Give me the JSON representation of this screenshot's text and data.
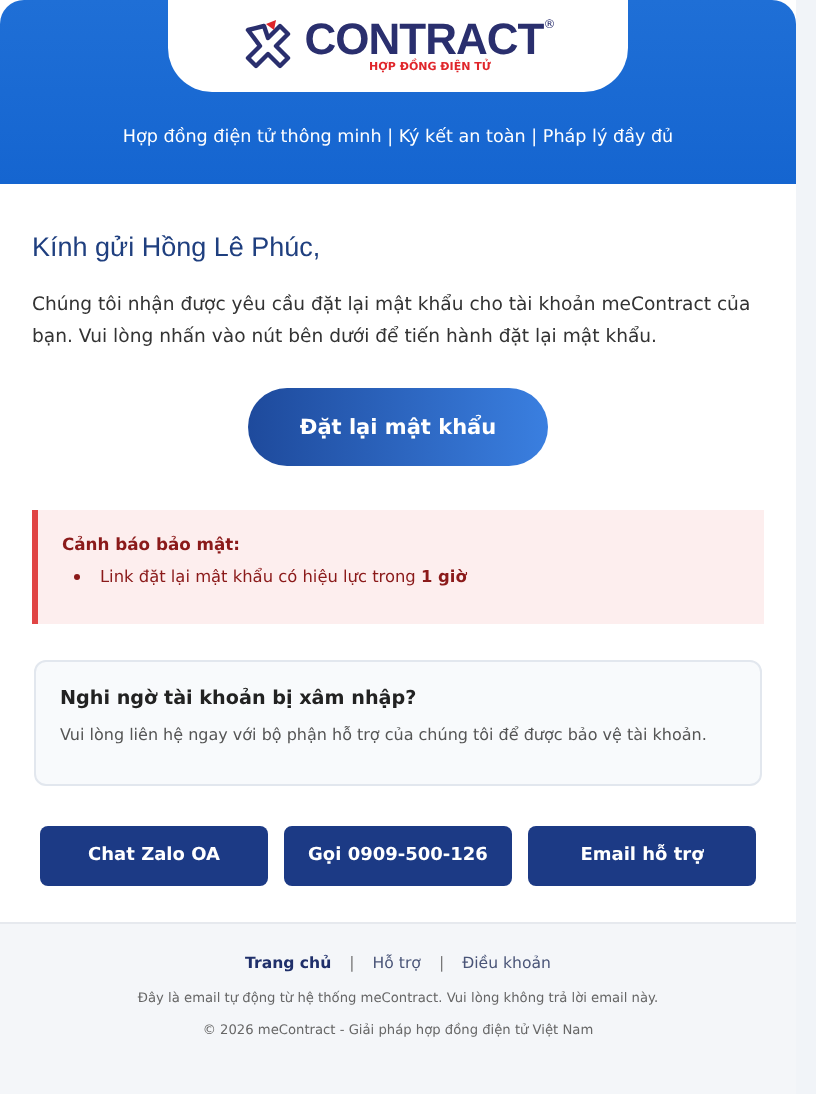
{
  "header": {
    "logo": {
      "wordmark": "CONTRACT",
      "registered": "®",
      "tagline": "HỢP ĐỒNG ĐIỆN TỬ"
    },
    "slogan": "Hợp đồng điện tử thông minh | Ký kết an toàn | Pháp lý đầy đủ"
  },
  "greeting": "Kính gửi Hồng Lê Phúc,",
  "message": "Chúng tôi nhận được yêu cầu đặt lại mật khẩu cho tài khoản meContract của bạn. Vui lòng nhấn vào nút bên dưới để tiến hành đặt lại mật khẩu.",
  "reset_button": "Đặt lại mật khẩu",
  "security_alert": {
    "title": "Cảnh báo bảo mật:",
    "items": [
      "Link đặt lại mật khẩu có hiệu lực trong **1 giờ**"
    ]
  },
  "suspicious_box": {
    "title": "Nghi ngờ tài khoản bị xâm nhập?",
    "text": "Vui lòng liên hệ ngay với bộ phận hỗ trợ của chúng tôi để được bảo vệ tài khoản."
  },
  "support_buttons": [
    "Chat Zalo OA",
    "Gọi 0909-500-126",
    "Email hỗ trợ"
  ],
  "footer": {
    "links": [
      {
        "label": "Trang chủ",
        "selected": true
      },
      {
        "label": "Hỗ trợ",
        "selected": false
      },
      {
        "label": "Điều khoản",
        "selected": false
      }
    ],
    "separator": "|",
    "notice": "Đây là email tự động từ hệ thống meContract. Vui lòng không trả lời email này.",
    "copyright": "© 2026 meContract - Giải pháp hợp đồng điện tử Việt Nam"
  }
}
